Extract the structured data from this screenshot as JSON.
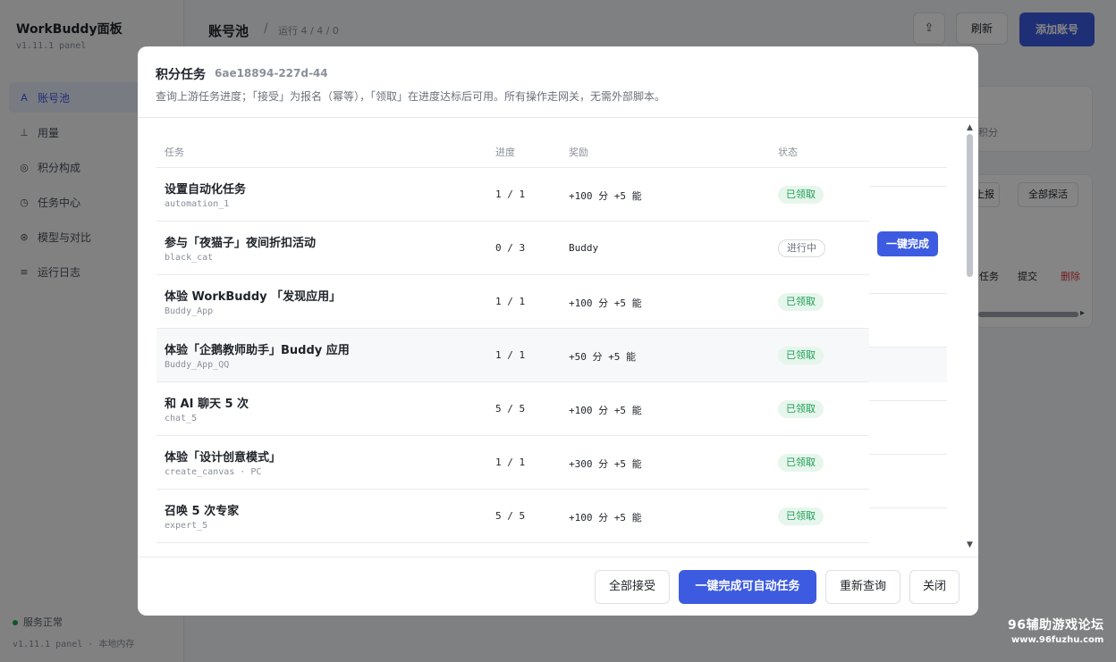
{
  "app": {
    "brand": "WorkBuddy面板",
    "version": "v1.11.1 panel",
    "nav": [
      {
        "icon": "A",
        "label": "账号池"
      },
      {
        "icon": "⊥",
        "label": "用量"
      },
      {
        "icon": "◎",
        "label": "积分构成"
      },
      {
        "icon": "◷",
        "label": "任务中心"
      },
      {
        "icon": "⊛",
        "label": "模型与对比"
      },
      {
        "icon": "≡",
        "label": "运行日志"
      }
    ],
    "status": "服务正常",
    "footer_version": "v1.11.1 panel · 本地内存"
  },
  "topbar": {
    "title": "账号池",
    "separator": "/",
    "subtitle": "运行 4 / 4 / 0",
    "icon_glyph": "⇪",
    "refresh_label": "刷新",
    "add_label": "添加账号"
  },
  "bg": {
    "card_text": "积分",
    "btn1": "上报",
    "btn2": "全部探活",
    "link1": "任务",
    "link2": "提交",
    "link3": "删除",
    "arrow": "▸"
  },
  "modal": {
    "title": "积分任务",
    "id": "6ae18894-227d-44",
    "description": "查询上游任务进度；「接受」为报名（幂等），「领取」在进度达标后可用。所有操作走网关，无需外部脚本。",
    "columns": {
      "task": "任务",
      "progress": "进度",
      "reward": "奖励",
      "status": "状态"
    },
    "rows": [
      {
        "name": "设置自动化任务",
        "key": "automation_1",
        "progress": "1 / 1",
        "reward": "+100 分 +5 能",
        "status": "已领取"
      },
      {
        "name": "参与「夜猫子」夜间折扣活动",
        "key": "black_cat",
        "progress": "0 / 3",
        "reward": "Buddy",
        "status": "进行中"
      },
      {
        "name": "体验 WorkBuddy 「发现应用」",
        "key": "Buddy_App",
        "progress": "1 / 1",
        "reward": "+100 分 +5 能",
        "status": "已领取"
      },
      {
        "name": "体验「企鹅教师助手」Buddy 应用",
        "key": "Buddy_App_QQ",
        "progress": "1 / 1",
        "reward": "+50 分 +5 能",
        "status": "已领取"
      },
      {
        "name": "和 AI 聊天 5 次",
        "key": "chat_5",
        "progress": "5 / 5",
        "reward": "+100 分 +5 能",
        "status": "已领取"
      },
      {
        "name": "体验「设计创意模式」",
        "key": "create_canvas · PC",
        "progress": "1 / 1",
        "reward": "+300 分 +5 能",
        "status": "已领取"
      },
      {
        "name": "召唤 5 次专家",
        "key": "expert_5",
        "progress": "5 / 5",
        "reward": "+100 分 +5 能",
        "status": "已领取"
      }
    ],
    "row_action": "一键完成",
    "scroll_up": "▲",
    "scroll_down": "▼",
    "footer": {
      "accept_all": "全部接受",
      "auto_complete": "一键完成可自动任务",
      "requery": "重新查询",
      "close": "关闭"
    }
  },
  "watermark": {
    "line1": "96辅助游戏论坛",
    "line2": "www.96fuzhu.com"
  }
}
